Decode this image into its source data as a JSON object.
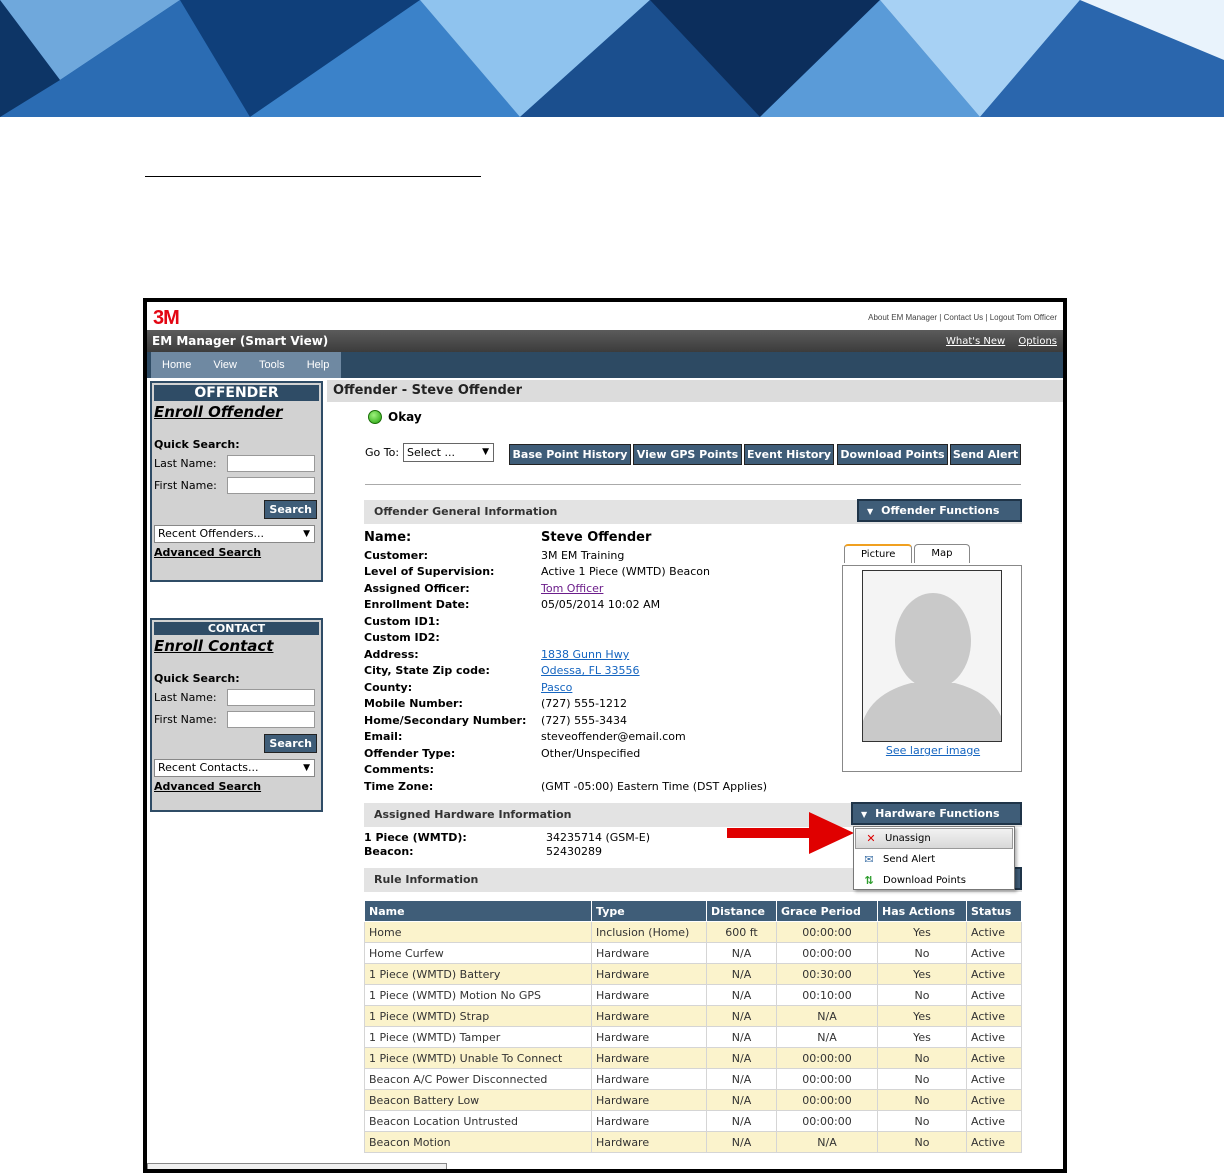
{
  "app": {
    "logo": "3M",
    "top_links": [
      "About EM Manager",
      "Contact Us",
      "Logout Tom Officer"
    ],
    "title": "EM Manager (Smart View)",
    "title_links": [
      "What's New",
      "Options"
    ],
    "menu": [
      "Home",
      "View",
      "Tools",
      "Help"
    ]
  },
  "offender_box": {
    "header": "OFFENDER",
    "enroll": "Enroll Offender",
    "quick_search": "Quick Search:",
    "last_name_label": "Last Name:",
    "first_name_label": "First Name:",
    "search_button": "Search",
    "recent": "Recent Offenders...",
    "advanced": "Advanced Search"
  },
  "contact_box": {
    "header": "CONTACT",
    "enroll": "Enroll Contact",
    "quick_search": "Quick Search:",
    "last_name_label": "Last Name:",
    "first_name_label": "First Name:",
    "search_button": "Search",
    "recent": "Recent Contacts...",
    "advanced": "Advanced Search"
  },
  "main": {
    "heading": "Offender - Steve Offender",
    "status": "Okay",
    "goto_label": "Go To:",
    "goto_select": "Select ...",
    "actions": [
      "Base Point History",
      "View GPS Points",
      "Event History",
      "Download Points",
      "Send Alert"
    ]
  },
  "general": {
    "section_title": "Offender General Information",
    "functions_button": "Offender Functions",
    "rows": [
      {
        "k": "Name:",
        "v": "Steve Offender"
      },
      {
        "k": "Customer:",
        "v": "3M EM Training"
      },
      {
        "k": "Level of Supervision:",
        "v": "Active 1 Piece (WMTD) Beacon"
      },
      {
        "k": "Assigned Officer:",
        "v": "Tom Officer"
      },
      {
        "k": "Enrollment Date:",
        "v": "05/05/2014 10:02 AM"
      },
      {
        "k": "Custom ID1:",
        "v": ""
      },
      {
        "k": "Custom ID2:",
        "v": ""
      },
      {
        "k": "Address:",
        "v": "1838 Gunn Hwy"
      },
      {
        "k": "City, State Zip code:",
        "v": "Odessa, FL 33556"
      },
      {
        "k": "County:",
        "v": "Pasco"
      },
      {
        "k": "Mobile Number:",
        "v": "(727) 555-1212"
      },
      {
        "k": "Home/Secondary Number:",
        "v": "(727) 555-3434"
      },
      {
        "k": "Email:",
        "v": "steveoffender@email.com"
      },
      {
        "k": "Offender Type:",
        "v": "Other/Unspecified"
      },
      {
        "k": "Comments:",
        "v": ""
      },
      {
        "k": "Time Zone:",
        "v": "(GMT -05:00) Eastern Time (DST Applies)"
      }
    ],
    "tabs": [
      "Picture",
      "Map"
    ],
    "larger_image": "See larger image"
  },
  "hardware": {
    "section_title": "Assigned Hardware Information",
    "functions_button": "Hardware Functions",
    "rows": [
      {
        "k": "1 Piece (WMTD):",
        "v": "34235714 (GSM-E)"
      },
      {
        "k": "Beacon:",
        "v": "52430289"
      }
    ],
    "menu": [
      "Unassign",
      "Send Alert",
      "Download Points"
    ]
  },
  "rules": {
    "section_title": "Rule Information",
    "columns": [
      "Name",
      "Type",
      "Distance",
      "Grace Period",
      "Has Actions",
      "Status"
    ],
    "rows": [
      [
        "Home",
        "Inclusion (Home)",
        "600 ft",
        "00:00:00",
        "Yes",
        "Active"
      ],
      [
        "Home Curfew",
        "Hardware",
        "N/A",
        "00:00:00",
        "No",
        "Active"
      ],
      [
        "1 Piece (WMTD) Battery",
        "Hardware",
        "N/A",
        "00:30:00",
        "Yes",
        "Active"
      ],
      [
        "1 Piece (WMTD) Motion No GPS",
        "Hardware",
        "N/A",
        "00:10:00",
        "No",
        "Active"
      ],
      [
        "1 Piece (WMTD) Strap",
        "Hardware",
        "N/A",
        "N/A",
        "Yes",
        "Active"
      ],
      [
        "1 Piece (WMTD) Tamper",
        "Hardware",
        "N/A",
        "N/A",
        "Yes",
        "Active"
      ],
      [
        "1 Piece (WMTD) Unable To Connect",
        "Hardware",
        "N/A",
        "00:00:00",
        "No",
        "Active"
      ],
      [
        "Beacon A/C Power Disconnected",
        "Hardware",
        "N/A",
        "00:00:00",
        "No",
        "Active"
      ],
      [
        "Beacon Battery Low",
        "Hardware",
        "N/A",
        "00:00:00",
        "No",
        "Active"
      ],
      [
        "Beacon Location Untrusted",
        "Hardware",
        "N/A",
        "00:00:00",
        "No",
        "Active"
      ],
      [
        "Beacon Motion",
        "Hardware",
        "N/A",
        "N/A",
        "No",
        "Active"
      ]
    ]
  },
  "colors": {
    "accent": "#3f5d78",
    "row_highlight": "#fbf3cc",
    "logo": "#e30613",
    "callout_arrow": "#e00000"
  }
}
